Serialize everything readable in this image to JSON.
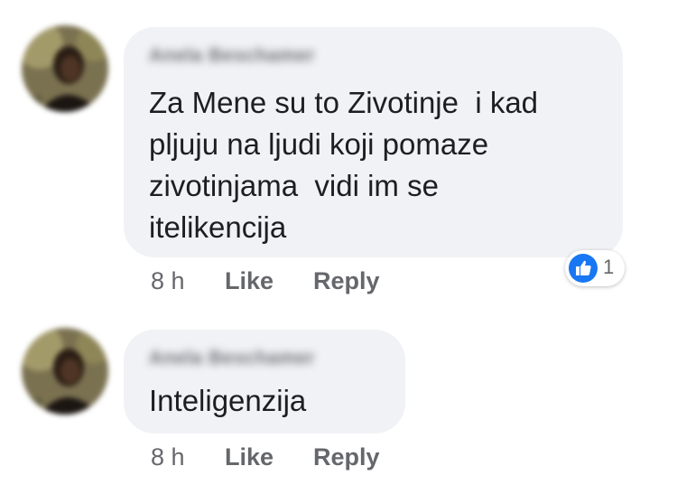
{
  "comments": [
    {
      "author": "Anela Beschamer",
      "text": "Za Mene su to Zivotinje  i kad\npljuju na ljudi koji pomaze\nzivotinjama  vidi im se\nitelikencija",
      "time": "8 h",
      "like_label": "Like",
      "reply_label": "Reply",
      "reaction_count": "1",
      "reaction_icon": "like-thumb-icon"
    },
    {
      "author": "Anela Beschamer",
      "text": "Inteligenzija",
      "time": "8 h",
      "like_label": "Like",
      "reply_label": "Reply"
    }
  ],
  "colors": {
    "bubble": "#f0f2f5",
    "text": "#1c1e21",
    "meta": "#65676b",
    "reaction": "#1877f2"
  }
}
